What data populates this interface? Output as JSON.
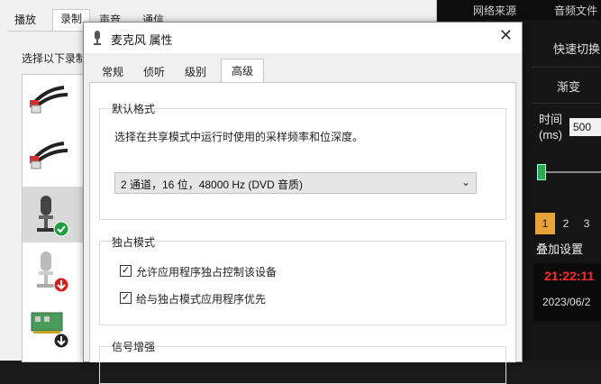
{
  "sound_dialog": {
    "tabs": [
      "播放",
      "录制",
      "声音",
      "通信"
    ],
    "active_tab": "录制",
    "instruction": "选择以下录制"
  },
  "mic_dialog": {
    "title": "麦克风 属性",
    "tabs": [
      "常规",
      "侦听",
      "级别",
      "高级"
    ],
    "active_tab": "高级",
    "default_format": {
      "group_title": "默认格式",
      "description": "选择在共享模式中运行时使用的采样频率和位深度。",
      "selected_value": "2 通道，16 位，48000 Hz (DVD 音质)"
    },
    "exclusive_mode": {
      "group_title": "独占模式",
      "options": [
        {
          "label": "允许应用程序独占控制该设备",
          "checked": true
        },
        {
          "label": "给与独占模式应用程序优先",
          "checked": true
        }
      ]
    },
    "signal_enhance": {
      "group_title": "信号增强"
    }
  },
  "dark_app": {
    "tabs": [
      "网络来源",
      "音频文件"
    ],
    "buttons": [
      "快速切换",
      "渐变"
    ],
    "time_label": "时间\n(ms)",
    "time_value": "500",
    "page_tabs": [
      "1",
      "2",
      "3"
    ],
    "active_page": "1",
    "overlay_button": "叠加设置",
    "clock_time": "21:22:11",
    "clock_date": "2023/06/2",
    "colors": {
      "accent": "#e8a23a",
      "clock_red": "#ff2b2b",
      "slider": "#2fa84f"
    }
  }
}
